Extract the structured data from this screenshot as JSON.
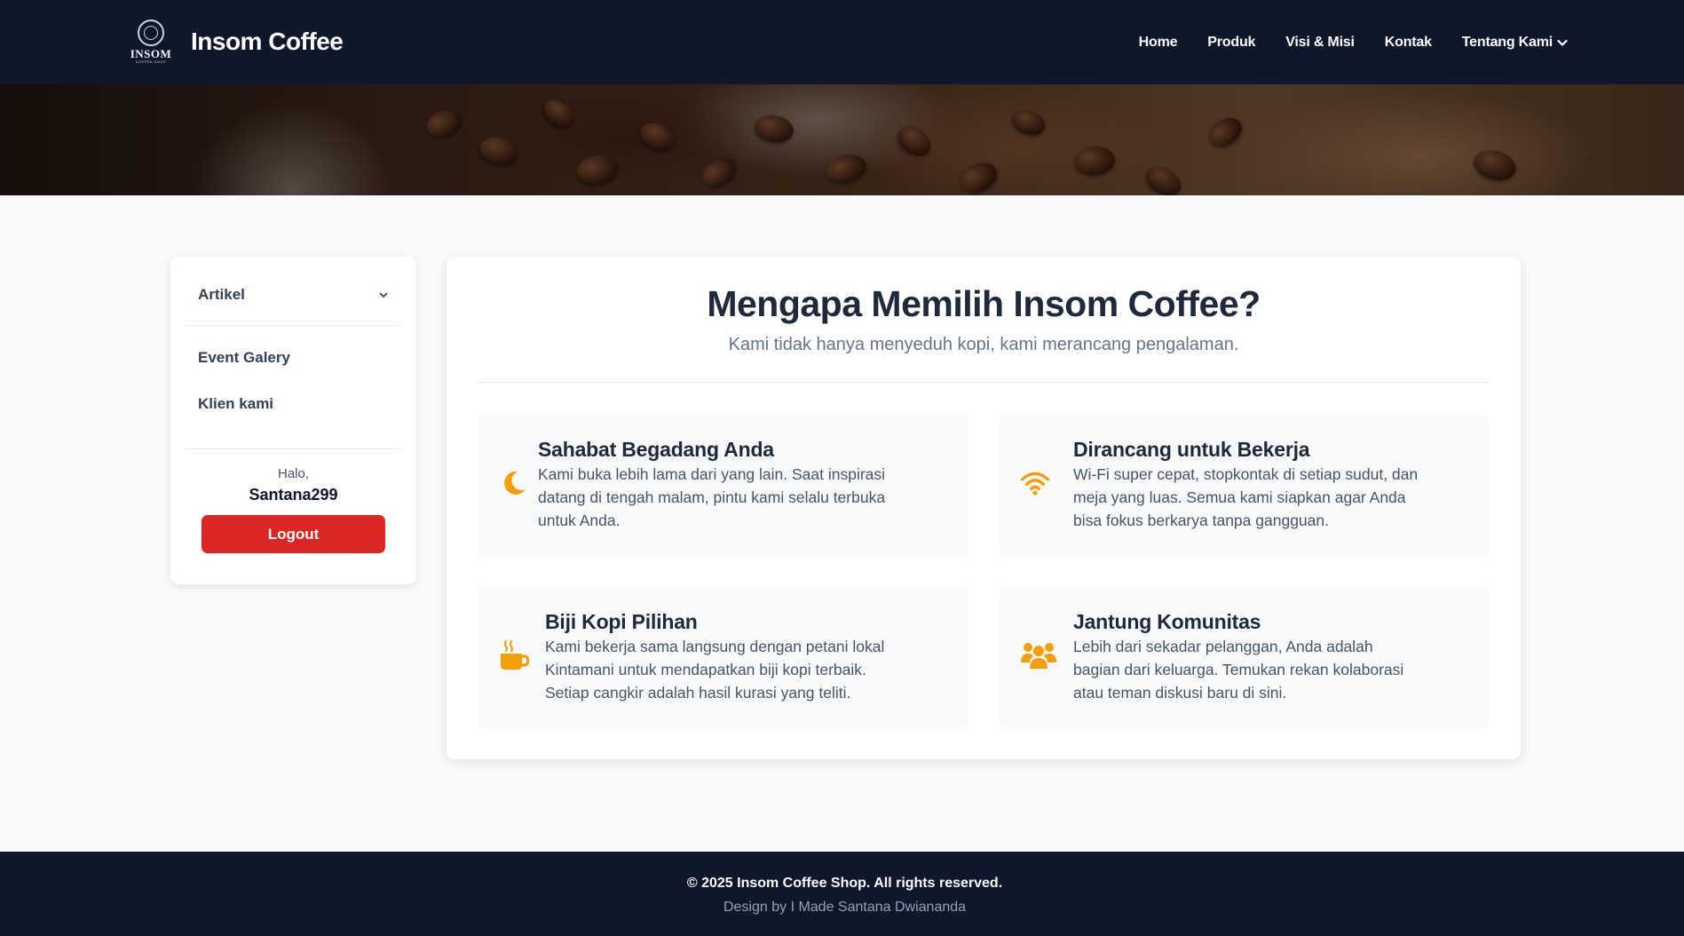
{
  "brand": {
    "logo_word": "INSOM",
    "logo_sub": "COFFEE SHOP",
    "title": "Insom Coffee"
  },
  "nav": {
    "items": [
      {
        "label": "Home"
      },
      {
        "label": "Produk"
      },
      {
        "label": "Visi & Misi"
      },
      {
        "label": "Kontak"
      },
      {
        "label": "Tentang Kami"
      }
    ]
  },
  "sidebar": {
    "dropdown_label": "Artikel",
    "links": [
      {
        "label": "Event Galery"
      },
      {
        "label": "Klien kami"
      }
    ],
    "greeting": "Halo,",
    "username": "Santana299",
    "logout_label": "Logout"
  },
  "main": {
    "title": "Mengapa Memilih Insom Coffee?",
    "subtitle": "Kami tidak hanya menyeduh kopi, kami merancang pengalaman.",
    "features": [
      {
        "icon": "moon-icon",
        "title": "Sahabat Begadang Anda",
        "line1": "Kami buka lebih lama dari yang lain. Saat inspirasi",
        "line2": "datang di tengah malam, pintu kami selalu terbuka",
        "line3": "untuk Anda."
      },
      {
        "icon": "wifi-icon",
        "title": "Dirancang untuk Bekerja",
        "line1": "Wi-Fi super cepat, stopkontak di setiap sudut, dan",
        "line2": "meja yang luas. Semua kami siapkan agar Anda",
        "line3": "bisa fokus berkarya tanpa gangguan."
      },
      {
        "icon": "coffee-cup-icon",
        "title": "Biji Kopi Pilihan",
        "line1": "Kami bekerja sama langsung dengan petani lokal",
        "line2": "Kintamani untuk mendapatkan biji kopi terbaik.",
        "line3": "Setiap cangkir adalah hasil kurasi yang teliti."
      },
      {
        "icon": "users-icon",
        "title": "Jantung Komunitas",
        "line1": "Lebih dari sekadar pelanggan, Anda adalah",
        "line2": "bagian dari keluarga. Temukan rekan kolaborasi",
        "line3": "atau teman diskusi baru di sini."
      }
    ]
  },
  "footer": {
    "copyright": "© 2025 Insom Coffee Shop. All rights reserved.",
    "credit": "Design by I Made Santana Dwiananda"
  },
  "colors": {
    "navbar": "#0f172a",
    "accent_icon": "#f59e0b",
    "logout": "#dc2626",
    "page_bg": "#f8fafc"
  }
}
